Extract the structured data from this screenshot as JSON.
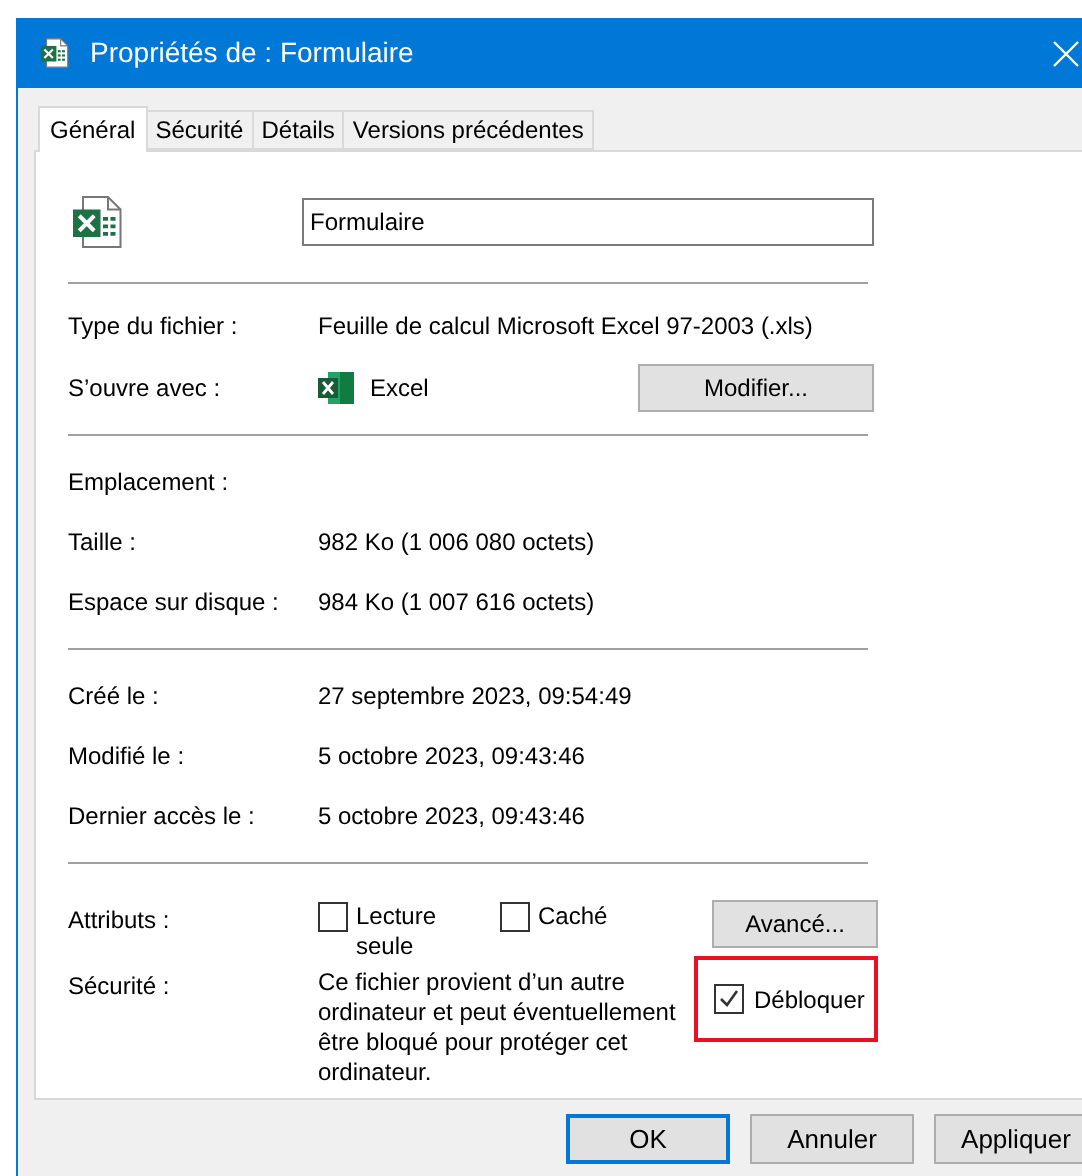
{
  "window": {
    "title": "Propriétés de : Formulaire"
  },
  "tabs": [
    {
      "label": "Général",
      "selected": true
    },
    {
      "label": "Sécurité",
      "selected": false
    },
    {
      "label": "Détails",
      "selected": false
    },
    {
      "label": "Versions précédentes",
      "selected": false
    }
  ],
  "file_name": {
    "value": "Formulaire"
  },
  "sections": [
    [
      {
        "kind": "text",
        "label": "Type du fichier :",
        "value": "Feuille de calcul Microsoft Excel 97-2003 (.xls)"
      },
      {
        "kind": "app",
        "label": "S’ouvre avec :",
        "value": "Excel",
        "button": "Modifier..."
      }
    ],
    [
      {
        "kind": "text",
        "label": "Emplacement :"
      },
      {
        "kind": "text",
        "label": "Taille :",
        "value": "982 Ko (1 006 080 octets)"
      },
      {
        "kind": "text",
        "label": "Espace sur disque :",
        "value": "984 Ko (1 007 616 octets)"
      }
    ],
    [
      {
        "kind": "text",
        "label": "Créé le :",
        "value": "27 septembre 2023, 09:54:49"
      },
      {
        "kind": "text",
        "label": "Modifié le :",
        "value": "5 octobre 2023, 09:43:46"
      },
      {
        "kind": "text",
        "label": "Dernier accès le :",
        "value": "5 octobre 2023, 09:43:46"
      }
    ],
    [
      {
        "kind": "attributes",
        "label": "Attributs :",
        "checkboxes": [
          {
            "label": "Lecture seule",
            "checked": false
          },
          {
            "label": "Caché",
            "checked": false
          }
        ],
        "button": "Avancé..."
      },
      {
        "kind": "security",
        "label": "Sécurité :",
        "text": "Ce fichier provient d’un autre ordinateur et peut éventuellement être bloqué pour protéger cet ordinateur.",
        "checkbox": {
          "label": "Débloquer",
          "checked": true,
          "highlighted": true
        }
      }
    ]
  ],
  "buttons": [
    {
      "label": "OK",
      "default": true
    },
    {
      "label": "Annuler",
      "default": false
    },
    {
      "label": "Appliquer",
      "default": false
    }
  ]
}
